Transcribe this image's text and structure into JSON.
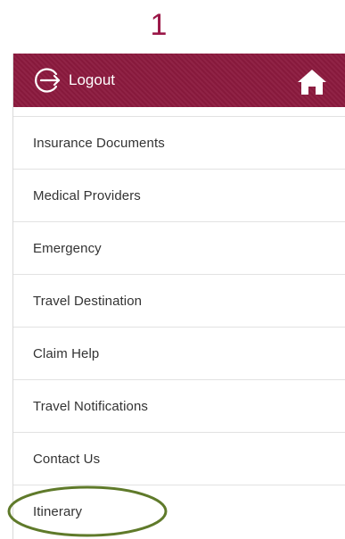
{
  "step": {
    "number": "1"
  },
  "header": {
    "logout_label": "Logout",
    "logout_icon": "logout-arrow-circle-icon",
    "home_icon": "home-icon",
    "background_color": "#8c1a3e"
  },
  "menu": {
    "items": [
      {
        "label": "Insurance Documents"
      },
      {
        "label": "Medical Providers"
      },
      {
        "label": "Emergency"
      },
      {
        "label": "Travel Destination"
      },
      {
        "label": "Claim Help"
      },
      {
        "label": "Travel Notifications"
      },
      {
        "label": "Contact Us"
      },
      {
        "label": "Itinerary"
      }
    ]
  },
  "annotation": {
    "highlighted_item": "Itinerary",
    "color": "#5f7a2a"
  }
}
